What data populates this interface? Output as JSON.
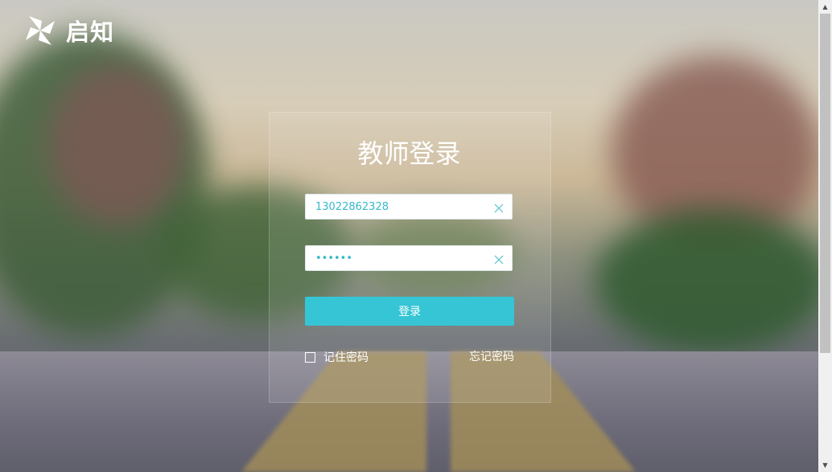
{
  "brand": {
    "logo_icon": "pinwheel-icon",
    "name": "启知"
  },
  "login": {
    "title": "教师登录",
    "username_value": "13022862328",
    "password_value": "••••••",
    "clear_icon": "close-icon",
    "submit_label": "登录",
    "remember_label": "记住密码",
    "remember_checked": false,
    "forgot_label": "忘记密码"
  },
  "colors": {
    "accent": "#35c5d4",
    "input_text": "#37b9c8"
  }
}
